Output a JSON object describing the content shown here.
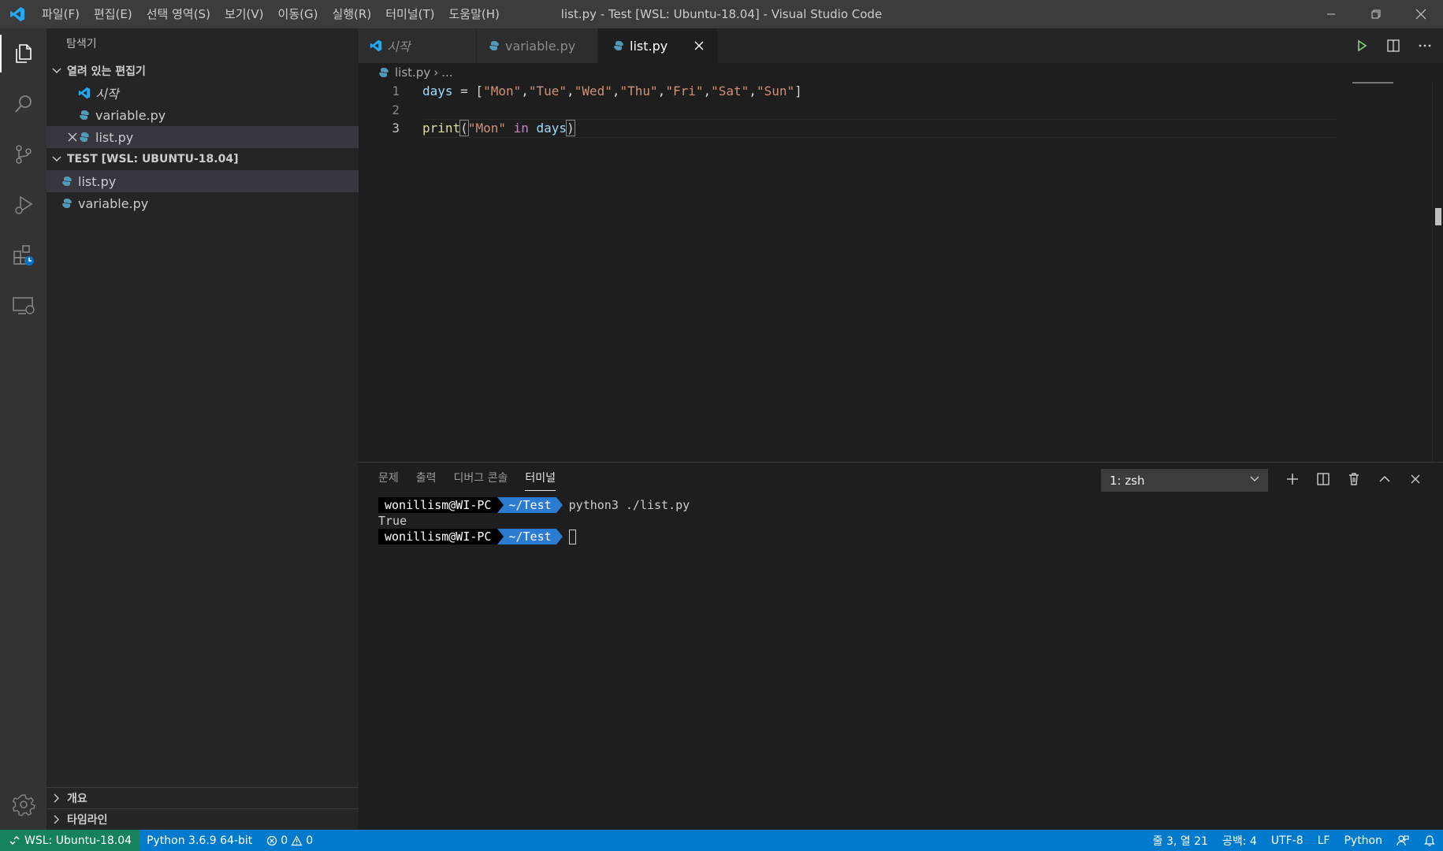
{
  "window": {
    "title": "list.py - Test [WSL: Ubuntu-18.04] - Visual Studio Code",
    "menu": [
      "파일(F)",
      "편집(E)",
      "선택 영역(S)",
      "보기(V)",
      "이동(G)",
      "실행(R)",
      "터미널(T)",
      "도움말(H)"
    ]
  },
  "activitybar": {
    "items": [
      "explorer-icon",
      "search-icon",
      "source-control-icon",
      "run-debug-icon",
      "extensions-icon",
      "remote-explorer-icon"
    ],
    "bottom": [
      "settings-gear-icon"
    ]
  },
  "sidebar": {
    "title": "탐색기",
    "open_editors": {
      "header": "열려 있는 편집기",
      "items": [
        {
          "label": "시작",
          "icon": "vscode-icon"
        },
        {
          "label": "variable.py",
          "icon": "python-icon"
        },
        {
          "label": "list.py",
          "icon": "python-icon",
          "selected": true
        }
      ]
    },
    "workspace": {
      "header": "TEST [WSL: UBUNTU-18.04]",
      "items": [
        {
          "label": "list.py",
          "selected": true
        },
        {
          "label": "variable.py"
        }
      ]
    },
    "outline": "개요",
    "timeline": "타임라인"
  },
  "editor": {
    "tabs": [
      {
        "label": "시작",
        "icon": "vscode-icon"
      },
      {
        "label": "variable.py",
        "icon": "python-icon"
      },
      {
        "label": "list.py",
        "icon": "python-icon",
        "active": true
      }
    ],
    "breadcrumb": {
      "file": "list.py",
      "rest": "..."
    },
    "lines": [
      {
        "n": "1",
        "text": "days = [\"Mon\",\"Tue\",\"Wed\",\"Thu\",\"Fri\",\"Sat\",\"Sun\"]"
      },
      {
        "n": "2",
        "text": ""
      },
      {
        "n": "3",
        "text": "print(\"Mon\" in days)"
      }
    ]
  },
  "panel": {
    "tabs": [
      "문제",
      "출력",
      "디버그 콘솔",
      "터미널"
    ],
    "active_tab": "터미널",
    "terminal_select": "1: zsh",
    "terminal": {
      "user": "wonillism@WI-PC",
      "dir": "~/Test",
      "command": "python3 ./list.py",
      "output": "True"
    }
  },
  "statusbar": {
    "remote": "WSL: Ubuntu-18.04",
    "interpreter": "Python 3.6.9 64-bit",
    "errors": "0",
    "warnings": "0",
    "position": "줄 3, 열 21",
    "spaces": "공백: 4",
    "encoding": "UTF-8",
    "eol": "LF",
    "language": "Python"
  },
  "colors": {
    "accent": "#007acc",
    "remote": "#16825d",
    "python_icon": "#519aba",
    "vscode_blue": "#23a9f2"
  }
}
